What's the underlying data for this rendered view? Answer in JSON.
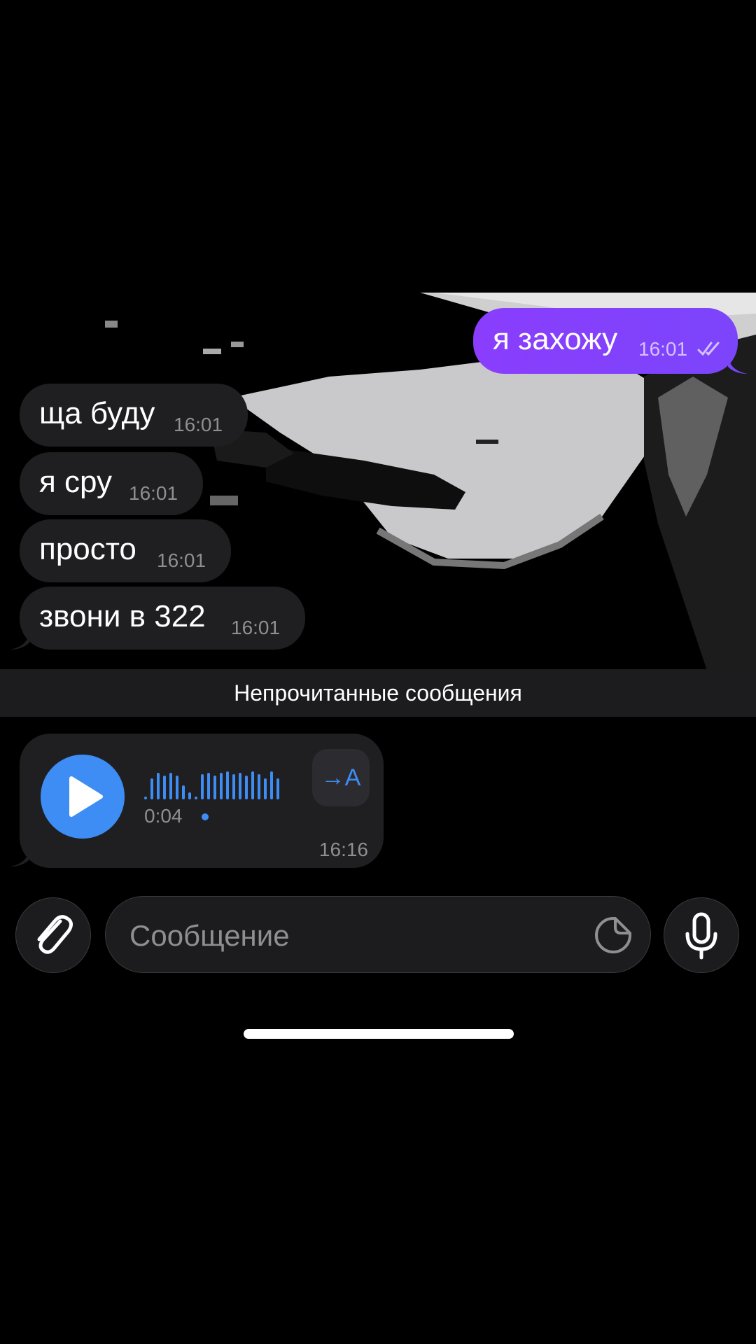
{
  "messages": {
    "outgoing": [
      {
        "text": "я захожу",
        "time": "16:01",
        "status": "read"
      }
    ],
    "incoming": [
      {
        "text": "ща буду",
        "time": "16:01"
      },
      {
        "text": "я сру",
        "time": "16:01"
      },
      {
        "text": "просто",
        "time": "16:01"
      },
      {
        "text": "звони в 322",
        "time": "16:01"
      }
    ]
  },
  "unread_divider": "Непрочитанные сообщения",
  "voice_message": {
    "duration": "0:04",
    "time": "16:16",
    "transcribe_label": "→A",
    "unplayed": true
  },
  "composer": {
    "placeholder": "Сообщение"
  },
  "colors": {
    "outgoing_bubble": "#8a3dfd",
    "incoming_bubble": "#1f1f22",
    "accent": "#3d8df5",
    "divider_bg": "#1c1c1e"
  },
  "icons": [
    "attach-icon",
    "sticker-icon",
    "microphone-icon",
    "play-icon",
    "double-check-icon",
    "waveform-icon"
  ]
}
